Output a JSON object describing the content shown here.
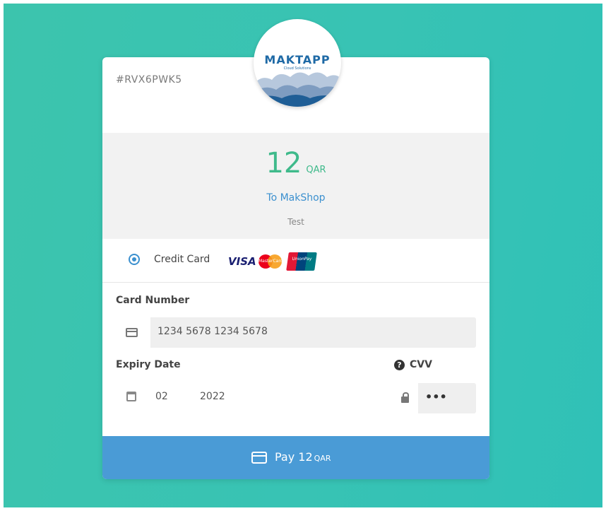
{
  "order": {
    "id": "#RVX6PWK5"
  },
  "logo": {
    "name": "MAKTAPP",
    "tagline": "Cloud Solutions"
  },
  "summary": {
    "amount": "12",
    "currency": "QAR",
    "merchant": "To MakShop",
    "note": "Test"
  },
  "payment_method": {
    "label": "Credit Card",
    "selected": true,
    "brands": [
      "VISA",
      "MasterCard",
      "UnionPay"
    ]
  },
  "form": {
    "card_number_label": "Card Number",
    "card_number_value": "1234 5678 1234 5678",
    "expiry_label": "Expiry Date",
    "expiry_month": "02",
    "expiry_year": "2022",
    "cvv_label": "CVV",
    "cvv_value": "•••"
  },
  "pay_button": {
    "text": "Pay 12",
    "currency": "QAR"
  },
  "colors": {
    "accent_green": "#3fba8b",
    "accent_blue": "#4a9bd6",
    "background": "#3cc4ad"
  },
  "icons": [
    "credit-card-icon",
    "calendar-icon",
    "question-circle-icon",
    "lock-icon",
    "radio-checked-icon"
  ]
}
